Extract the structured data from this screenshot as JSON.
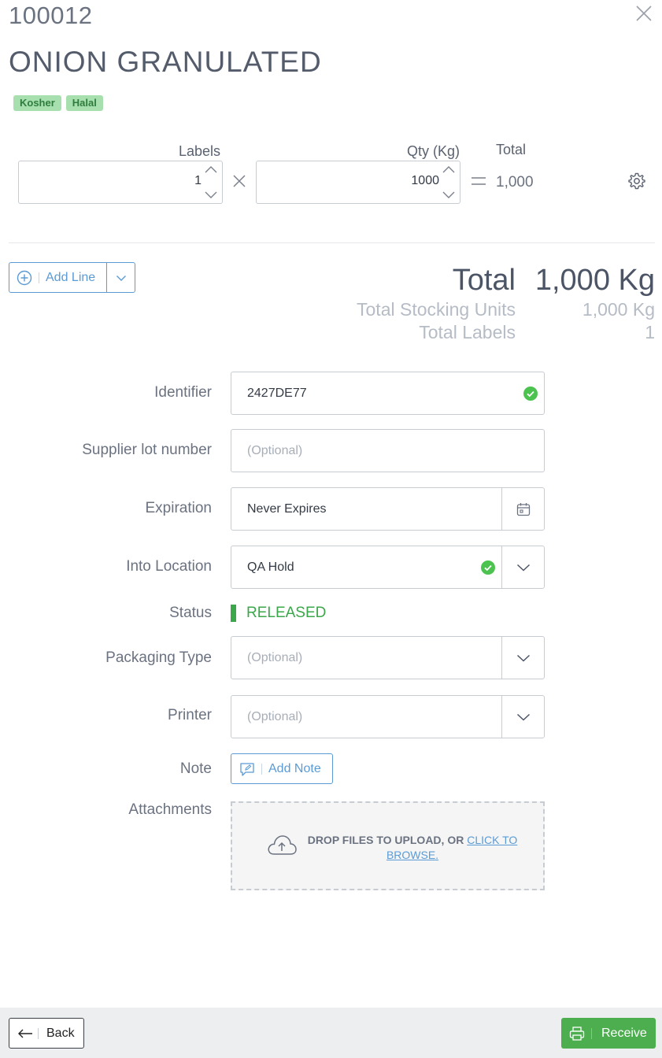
{
  "header": {
    "item_code": "100012",
    "item_name": "ONION GRANULATED",
    "tags": [
      "Kosher",
      "Halal"
    ]
  },
  "quantity_row": {
    "labels_label": "Labels",
    "labels_value": "1",
    "qty_label": "Qty (Kg)",
    "qty_value": "1000",
    "total_label": "Total",
    "total_value": "1,000"
  },
  "add_line": {
    "label": "Add Line"
  },
  "summary": {
    "total_label": "Total",
    "total_value": "1,000 Kg",
    "stocking_label": "Total Stocking Units",
    "stocking_value": "1,000 Kg",
    "labels_label": "Total Labels",
    "labels_value": "1"
  },
  "form": {
    "identifier": {
      "label": "Identifier",
      "value": "2427DE77"
    },
    "supplier_lot": {
      "label": "Supplier lot number",
      "placeholder": "(Optional)"
    },
    "expiration": {
      "label": "Expiration",
      "value": "Never Expires"
    },
    "into_location": {
      "label": "Into Location",
      "value": "QA Hold"
    },
    "status": {
      "label": "Status",
      "value": "RELEASED"
    },
    "packaging_type": {
      "label": "Packaging Type",
      "placeholder": "(Optional)"
    },
    "printer": {
      "label": "Printer",
      "placeholder": "(Optional)"
    },
    "note": {
      "label": "Note",
      "button": "Add Note"
    },
    "attachments": {
      "label": "Attachments",
      "drop_text": "DROP FILES TO UPLOAD, OR",
      "browse_text": "CLICK TO BROWSE."
    }
  },
  "footer": {
    "back_label": "Back",
    "receive_label": "Receive"
  },
  "colors": {
    "accent_blue": "#5b9bd5",
    "success_green": "#4cae4f",
    "tag_bg": "#a7dfae"
  }
}
